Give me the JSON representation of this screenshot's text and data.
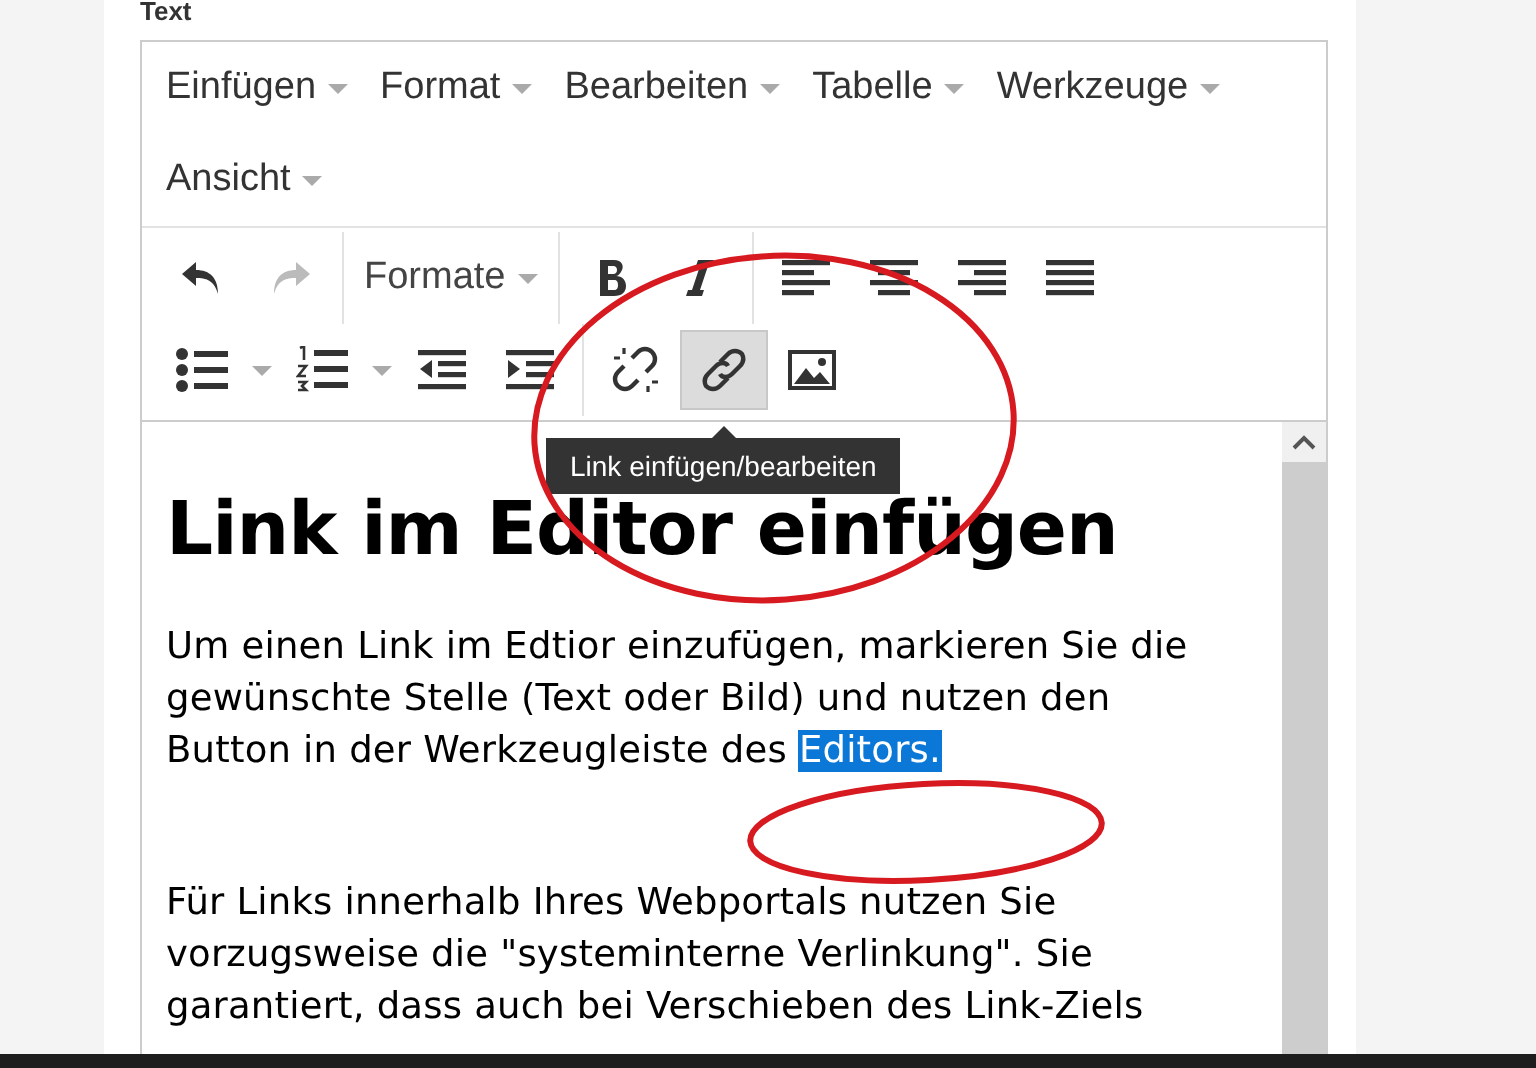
{
  "field_label": "Text",
  "menubar": [
    {
      "label": "Einfügen"
    },
    {
      "label": "Format"
    },
    {
      "label": "Bearbeiten"
    },
    {
      "label": "Tabelle"
    },
    {
      "label": "Werkzeuge"
    },
    {
      "label": "Ansicht"
    }
  ],
  "toolbar": {
    "undo": {
      "disabled": false
    },
    "redo": {
      "disabled": true
    },
    "formats": {
      "label": "Formate"
    },
    "link": {
      "pressed": true
    }
  },
  "tooltip": {
    "text": "Link einfügen/bearbeiten"
  },
  "content": {
    "heading": "Link im Editor einfügen",
    "paragraphs": [
      {
        "text": "Um einen Link im Edtior einzufügen, markieren Sie die gewünschte Stelle (Text oder Bild) und nutzen den Button in der Werkzeugleiste des ",
        "selected_text": "Editors."
      },
      {
        "text": "Für Links innerhalb Ihres Webportals nutzen Sie vorzugsweise die \"systeminterne Verlinkung\". Sie garantiert, dass auch bei Verschieben des Link-Ziels"
      }
    ]
  }
}
